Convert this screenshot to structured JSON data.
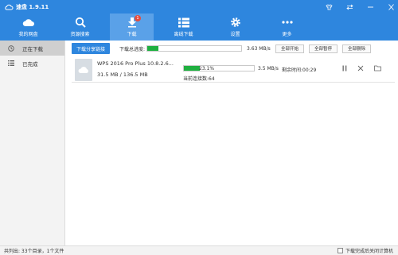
{
  "app": {
    "title": "速盘 1.9.11"
  },
  "window_controls": [
    "shirt-icon",
    "swap-icon",
    "minimize-icon",
    "close-icon"
  ],
  "toolbar": {
    "items": [
      {
        "label": "我的网盘",
        "icon": "cloud-icon"
      },
      {
        "label": "资源搜索",
        "icon": "search-icon"
      },
      {
        "label": "下载",
        "icon": "download-icon",
        "badge": "1",
        "active": true
      },
      {
        "label": "离线下载",
        "icon": "list-icon"
      },
      {
        "label": "设置",
        "icon": "gear-icon"
      },
      {
        "label": "更多",
        "icon": "more-icon"
      }
    ]
  },
  "sidebar": {
    "items": [
      {
        "label": "正在下载",
        "icon": "clock-icon",
        "active": true
      },
      {
        "label": "已完成",
        "icon": "list-icon"
      }
    ]
  },
  "actions": {
    "share_label": "下载分享链接",
    "total_label": "下载总进度:",
    "total_progress": 0.12,
    "total_speed": "3.63 MB/s",
    "start_all": "全部开始",
    "pause_all": "全部暂停",
    "delete_all": "全部删除"
  },
  "task": {
    "filename": "WPS 2016 Pro Plus 10.8.2.6...",
    "size": "31.5 MB / 136.5 MB",
    "progress": 0.231,
    "progress_text": "23.1%",
    "speed": "3.5 MB/s",
    "remaining": "剩余时间:00:29",
    "connections": "当前连接数:64"
  },
  "status": {
    "count": "共列出: 33个目录，1个文件",
    "shutdown_label": "下载完成后关闭计算机"
  },
  "colors": {
    "accent": "#2e86de",
    "progress": "#1fb040",
    "badge": "#e74c3c"
  }
}
